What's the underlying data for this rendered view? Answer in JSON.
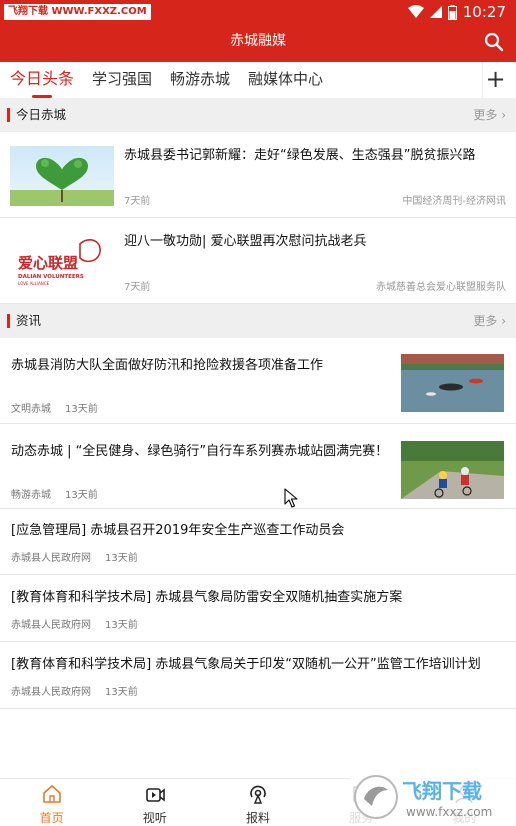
{
  "status": {
    "watermark": "飞翔下载 WWW.FXXZ.COM",
    "time": "10:27"
  },
  "appbar": {
    "title": "赤城融媒"
  },
  "tabs": [
    "今日头条",
    "学习强国",
    "畅游赤城",
    "融媒体中心"
  ],
  "tabs_more": "+",
  "section_chicheng": {
    "title": "今日赤城",
    "more": "更多"
  },
  "chicheng_items": [
    {
      "title": "赤城县委书记郭新耀：走好“绿色发展、生态强县”脱贫振兴路",
      "time": "7天前",
      "source": "中国经济周刊-经济网讯"
    },
    {
      "title": "迎八一敬功勋| 爱心联盟再次慰问抗战老兵",
      "time": "7天前",
      "source": "赤城慈善总会爱心联盟服务队",
      "logo_text": "爱心联盟",
      "logo_sub": "DALIAN VOLUNTEERS",
      "logo_sub2": "LOVE ALLIANCE"
    }
  ],
  "section_news": {
    "title": "资讯",
    "more": "更多"
  },
  "news_items": [
    {
      "title": "赤城县消防大队全面做好防汛和抢险救援各项准备工作",
      "source": "文明赤城",
      "time": "13天前"
    },
    {
      "title": "动态赤城 | “全民健身、绿色骑行”自行车系列赛赤城站圆满完赛！",
      "source": "畅游赤城",
      "time": "13天前"
    },
    {
      "title": "[应急管理局]  赤城县召开2019年安全生产巡查工作动员会",
      "source": "赤城县人民政府网",
      "time": "13天前"
    },
    {
      "title": "[教育体育和科学技术局]  赤城县气象局防雷安全双随机抽查实施方案",
      "source": "赤城县人民政府网",
      "time": "13天前"
    },
    {
      "title": "[教育体育和科学技术局]  赤城县气象局关于印发“双随机一公开”监管工作培训计划",
      "source": "赤城县人民政府网",
      "time": "13天前"
    }
  ],
  "bottom_nav": [
    "首页",
    "视听",
    "报料",
    "服务",
    "我的"
  ],
  "brand": {
    "text": "飞翔下载",
    "url": "www.fxxz.com"
  },
  "colors": {
    "primary": "#d6251a",
    "nav_active": "#e87a27"
  }
}
